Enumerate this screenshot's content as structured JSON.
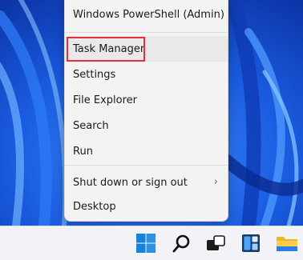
{
  "menu": {
    "items": [
      {
        "label": "Windows PowerShell (Admin)"
      },
      {
        "label": "Task Manager"
      },
      {
        "label": "Settings"
      },
      {
        "label": "File Explorer"
      },
      {
        "label": "Search"
      },
      {
        "label": "Run"
      },
      {
        "label": "Shut down or sign out",
        "submenu": true
      },
      {
        "label": "Desktop"
      }
    ]
  },
  "highlight_color": "#e0303a",
  "taskbar": {
    "icons": [
      "windows-start-icon",
      "search-icon",
      "task-view-icon",
      "widgets-icon",
      "file-explorer-icon"
    ]
  }
}
